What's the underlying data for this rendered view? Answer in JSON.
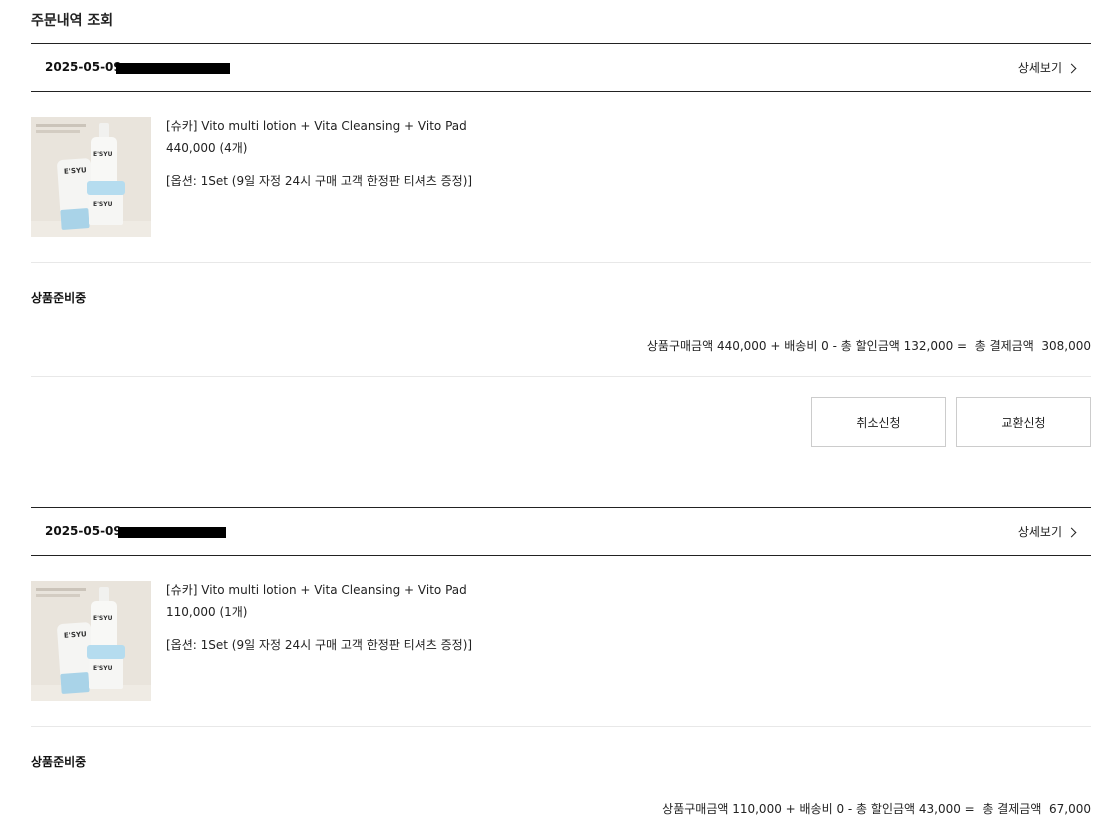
{
  "page": {
    "title": "주문내역 조회"
  },
  "detail_label": "상세보기",
  "orders": [
    {
      "date": "2025-05-09",
      "product": {
        "name": "[슈카] Vito multi lotion + Vita Cleansing + Vito Pad",
        "price": "440,000 (4개)",
        "option": "[옵션: 1Set (9일 자정 24시 구매 고객 한정판 티셔츠 증정)]",
        "thumb_brand": "E'SYU"
      },
      "status": "상품준비중",
      "summary": "상품구매금액 440,000 + 배송비 0 - 총 할인금액 132,000 =  총 결제금액  308,000",
      "buttons": {
        "cancel": "취소신청",
        "exchange": "교환신청"
      }
    },
    {
      "date": "2025-05-09",
      "product": {
        "name": "[슈카] Vito multi lotion + Vita Cleansing + Vito Pad",
        "price": "110,000 (1개)",
        "option": "[옵션: 1Set (9일 자정 24시 구매 고객 한정판 티셔츠 증정)]",
        "thumb_brand": "E'SYU"
      },
      "status": "상품준비중",
      "summary": "상품구매금액 110,000 + 배송비 0 - 총 할인금액 43,000 =  총 결제금액  67,000"
    }
  ]
}
